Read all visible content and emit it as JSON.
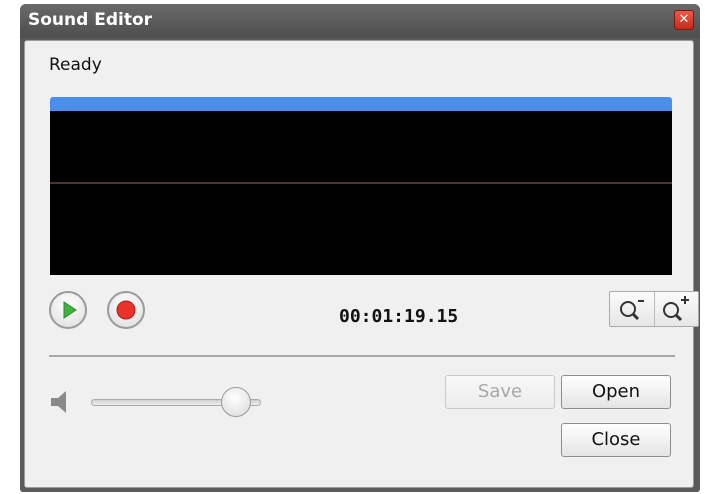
{
  "window": {
    "title": "Sound Editor"
  },
  "status": {
    "text": "Ready"
  },
  "player": {
    "time": "00:01:19.15"
  },
  "buttons": {
    "save": "Save",
    "open": "Open",
    "close": "Close"
  },
  "volume": {
    "level": 0.85
  },
  "icons": {
    "close": "close-icon",
    "play": "play-icon",
    "record": "record-icon",
    "zoom_out": "zoom-out-icon",
    "zoom_in": "zoom-in-icon",
    "volume": "speaker-icon"
  },
  "colors": {
    "scrub_bar": "#4a90e8",
    "waveform": "#ff5a5a",
    "play": "#3fb23f",
    "record": "#e8322a"
  }
}
